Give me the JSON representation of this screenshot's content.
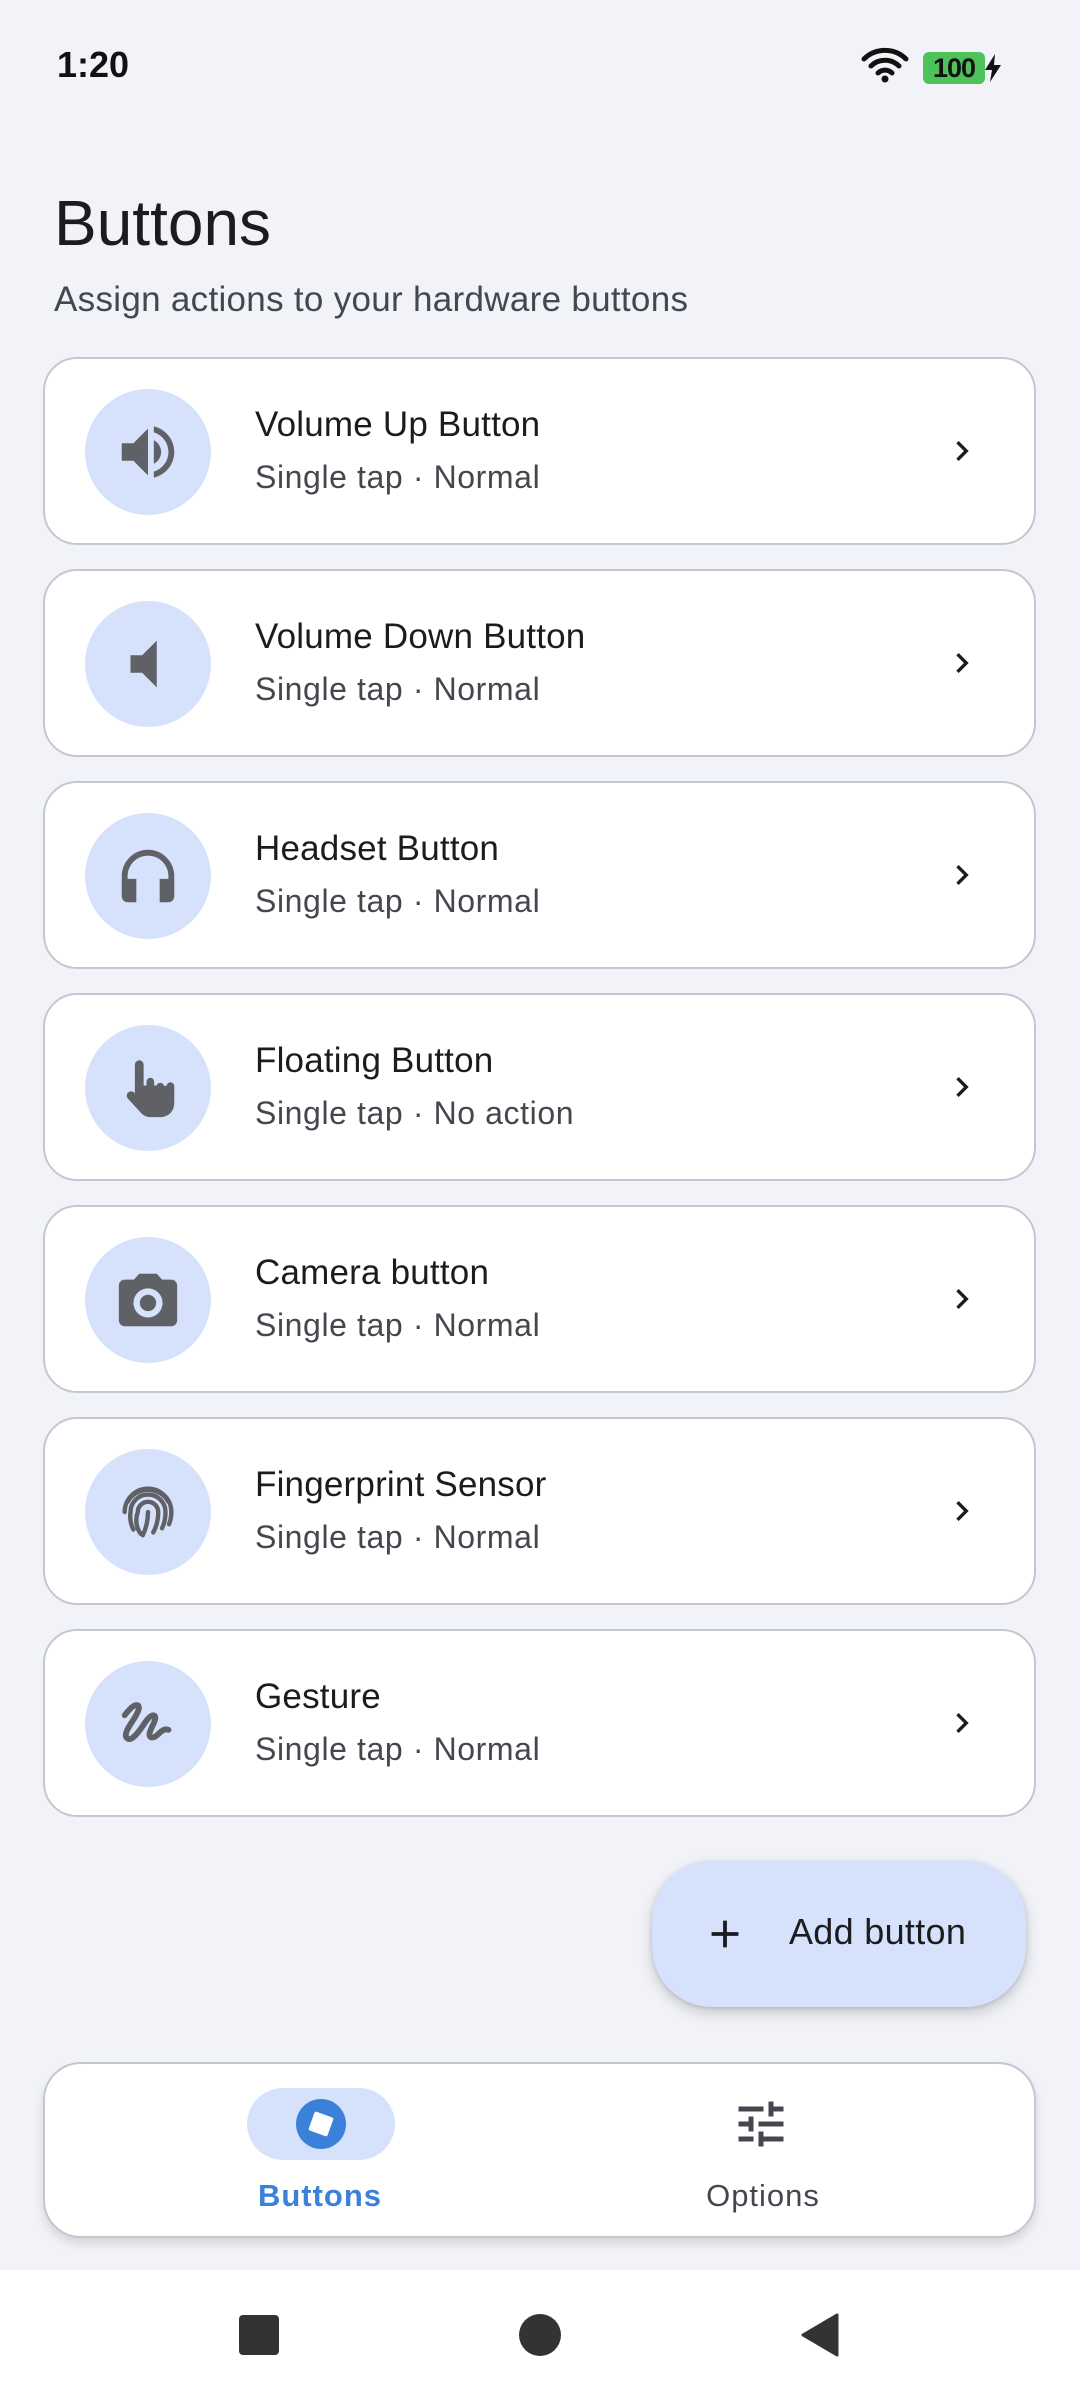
{
  "status_bar": {
    "time": "1:20",
    "battery_level": "100",
    "battery_color": "#4fc15a"
  },
  "header": {
    "title": "Buttons",
    "subtitle": "Assign actions to your hardware buttons"
  },
  "buttons": [
    {
      "title": "Volume Up Button",
      "subtitle": "Single tap · Normal",
      "icon": "volume-up-icon"
    },
    {
      "title": "Volume Down Button",
      "subtitle": "Single tap · Normal",
      "icon": "volume-down-icon"
    },
    {
      "title": "Headset Button",
      "subtitle": "Single tap · Normal",
      "icon": "headset-icon"
    },
    {
      "title": "Floating Button",
      "subtitle": "Single tap · No action",
      "icon": "touch-icon"
    },
    {
      "title": "Camera button",
      "subtitle": "Single tap · Normal",
      "icon": "camera-icon"
    },
    {
      "title": "Fingerprint Sensor",
      "subtitle": "Single tap · Normal",
      "icon": "fingerprint-icon"
    },
    {
      "title": "Gesture",
      "subtitle": "Single tap · Normal",
      "icon": "gesture-icon"
    }
  ],
  "fab": {
    "label": "Add button",
    "icon": "plus-icon"
  },
  "bottom_nav": {
    "items": [
      {
        "label": "Buttons",
        "icon": "buttons-nav-icon",
        "active": true
      },
      {
        "label": "Options",
        "icon": "tune-icon",
        "active": false
      }
    ]
  },
  "colors": {
    "background": "#f1f3f8",
    "accent": "#3b80d9",
    "icon_circle": "#d6e2fb",
    "icon_gray": "#5f6166"
  }
}
